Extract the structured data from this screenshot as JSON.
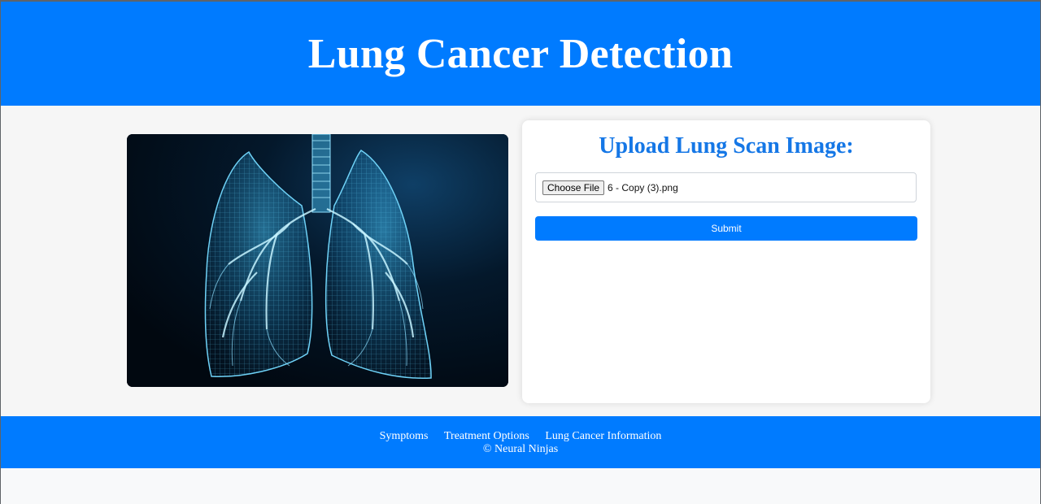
{
  "header": {
    "title": "Lung Cancer Detection"
  },
  "hero_image": {
    "description_icon": "lung-xray-illustration"
  },
  "upload_card": {
    "heading": "Upload Lung Scan Image:",
    "file_input": {
      "button_label": "Choose File",
      "selected_file": "6 - Copy (3).png"
    },
    "submit_label": "Submit"
  },
  "footer": {
    "links": [
      "Symptoms",
      "Treatment Options",
      "Lung Cancer Information"
    ],
    "copyright": "© Neural Ninjas"
  },
  "colors": {
    "primary": "#007bff",
    "heading_blue": "#1577e6",
    "page_background": "#f6f6f6",
    "card_background": "#ffffff"
  }
}
